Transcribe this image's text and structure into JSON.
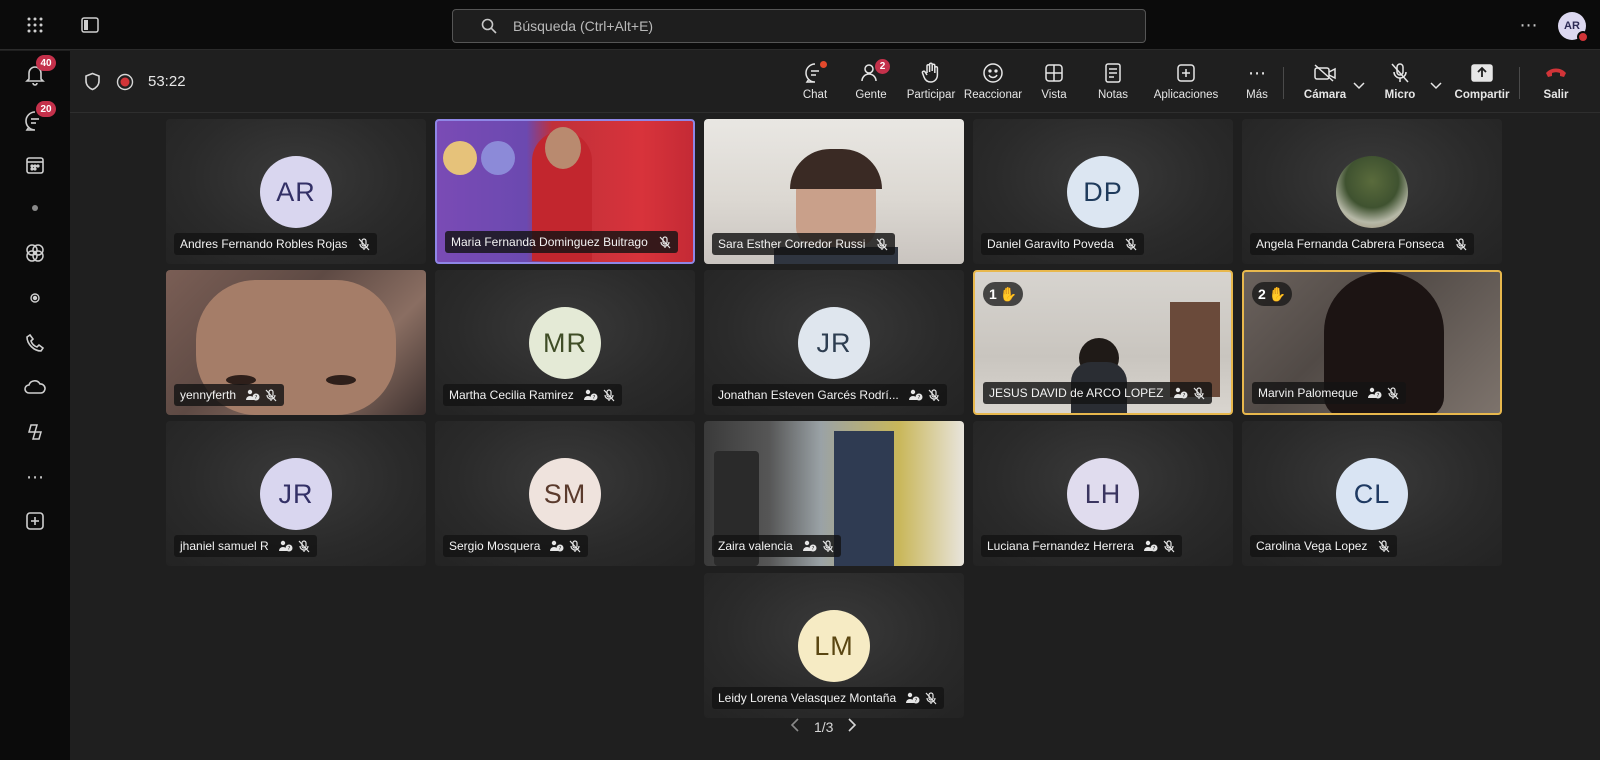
{
  "topbar": {
    "search_placeholder": "Búsqueda (Ctrl+Alt+E)",
    "avatar_initials": "AR"
  },
  "rail": {
    "activity_badge": "40",
    "chat_badge": "20"
  },
  "meeting": {
    "timer": "53:22",
    "controls": [
      {
        "label": "Chat",
        "icon": "chat-icon"
      },
      {
        "label": "Gente",
        "icon": "people-icon",
        "badge": "2"
      },
      {
        "label": "Participar",
        "icon": "raise-hand-icon"
      },
      {
        "label": "Reaccionar",
        "icon": "smile-icon"
      },
      {
        "label": "Vista",
        "icon": "grid-view-icon"
      },
      {
        "label": "Notas",
        "icon": "notes-icon"
      },
      {
        "label": "Aplicaciones",
        "icon": "add-app-icon"
      },
      {
        "label": "Más",
        "icon": "more-icon"
      }
    ],
    "camera_label": "Cámara",
    "mic_label": "Micro",
    "share_label": "Compartir",
    "leave_label": "Salir"
  },
  "participants": [
    {
      "name": "Andres Fernando Robles Rojas",
      "initials": "AR",
      "bg": "#d9d6ef",
      "fg": "#333066"
    },
    {
      "name": "Maria Fernanda Dominguez Buitrago",
      "video": true
    },
    {
      "name": "Sara Esther Corredor Russi",
      "video": true
    },
    {
      "name": "Daniel Garavito Poveda",
      "initials": "DP",
      "bg": "#dce6f2",
      "fg": "#1f3b5c"
    },
    {
      "name": "Angela Fernanda Cabrera Fonseca",
      "photo": true
    },
    {
      "name": "yennyferth",
      "video": true
    },
    {
      "name": "Martha Cecilia Ramirez",
      "initials": "MR",
      "bg": "#e4ead6",
      "fg": "#3f4d26"
    },
    {
      "name": "Jonathan Esteven Garcés Rodrí...",
      "initials": "JR",
      "bg": "#dfe6ee",
      "fg": "#2d3d50"
    },
    {
      "name": "JESUS DAVID de ARCO LOPEZ",
      "video": true,
      "hand": "1"
    },
    {
      "name": "Marvin Palomeque",
      "video": true,
      "hand": "2"
    },
    {
      "name": "jhaniel samuel R",
      "initials": "JR",
      "bg": "#d9d6ef",
      "fg": "#333066"
    },
    {
      "name": "Sergio Mosquera",
      "initials": "SM",
      "bg": "#efe3dd",
      "fg": "#5a3a2c"
    },
    {
      "name": "Zaira valencia",
      "video": true
    },
    {
      "name": "Luciana Fernandez Herrera",
      "initials": "LH",
      "bg": "#e0dcee",
      "fg": "#3a3560"
    },
    {
      "name": "Carolina Vega Lopez",
      "initials": "CL",
      "bg": "#d9e4f3",
      "fg": "#1f3a62"
    },
    {
      "name": "Leidy Lorena Velasquez Montaña",
      "initials": "LM",
      "bg": "#f6ebc4",
      "fg": "#5a4612"
    }
  ],
  "pager": {
    "text": "1/3"
  }
}
